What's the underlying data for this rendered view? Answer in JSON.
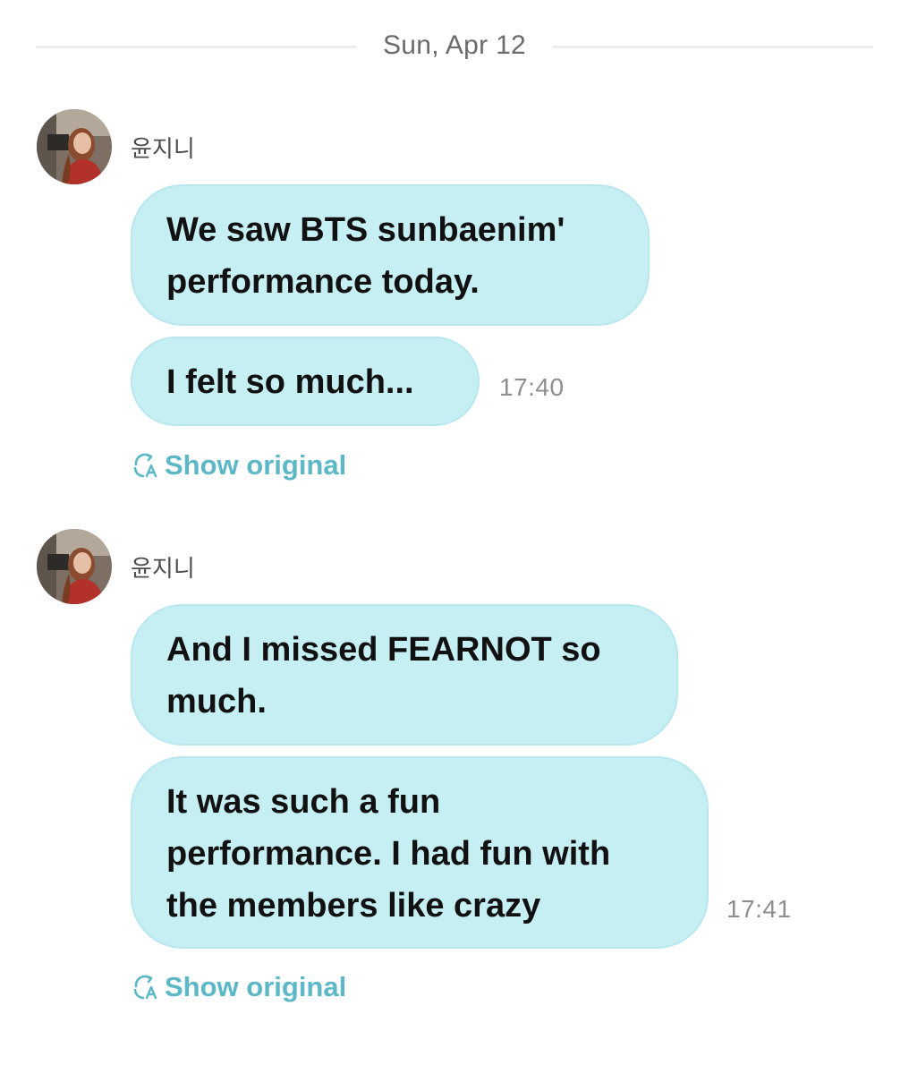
{
  "date_separator": "Sun, Apr 12",
  "groups": [
    {
      "sender": "윤지니",
      "avatar_icon": "profile-photo",
      "messages": [
        {
          "lines": [
            "We saw BTS sunbaenim'",
            "performance today."
          ]
        },
        {
          "lines": [
            "I felt so much..."
          ]
        }
      ],
      "time": "17:40",
      "show_original": "Show original"
    },
    {
      "sender": "윤지니",
      "avatar_icon": "profile-photo",
      "messages": [
        {
          "lines": [
            "And I missed FEARNOT so",
            "much."
          ]
        },
        {
          "lines": [
            "It was such a fun",
            "performance. I had fun with",
            "the members like crazy"
          ]
        }
      ],
      "time": "17:41",
      "show_original": "Show original"
    }
  ],
  "colors": {
    "bubble": "#c6eff4",
    "accent": "#5cb8c6",
    "time": "#8e8e8e"
  }
}
